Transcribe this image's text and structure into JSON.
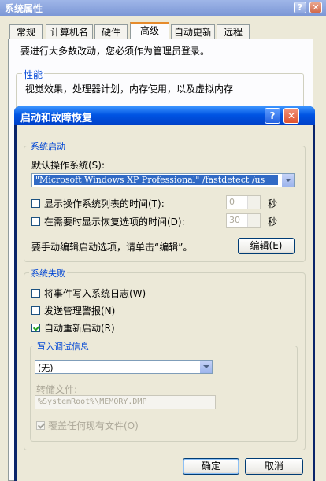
{
  "background_window": {
    "title": "系统属性",
    "tabs": [
      "常规",
      "计算机名",
      "硬件",
      "高级",
      "自动更新",
      "远程"
    ],
    "active_tab": "高级",
    "admin_notice": "要进行大多数改动，您必须作为管理员登录。",
    "performance": {
      "legend": "性能",
      "description": "视觉效果，处理器计划，内存使用，以及虚拟内存"
    }
  },
  "dialog": {
    "title": "启动和故障恢复",
    "help_glyph": "?",
    "close_glyph": "✕",
    "system_startup": {
      "legend": "系统启动",
      "default_os_label": "默认操作系统(S):",
      "default_os_value": "\"Microsoft Windows XP Professional\" /fastdetect  /us",
      "show_os_list_label": "显示操作系统列表的时间(T):",
      "show_os_list_value": "0",
      "show_recovery_label": "在需要时显示恢复选项的时间(D):",
      "show_recovery_value": "30",
      "seconds_unit": "秒",
      "edit_hint": "要手动编辑启动选项，请单击“编辑”。",
      "edit_button": "编辑(E)"
    },
    "system_failure": {
      "legend": "系统失败",
      "write_event_log": {
        "label": "将事件写入系统日志(W)",
        "checked": false
      },
      "send_alert": {
        "label": "发送管理警报(N)",
        "checked": false
      },
      "auto_restart": {
        "label": "自动重新启动(R)",
        "checked": true
      },
      "debug_info": {
        "legend": "写入调试信息",
        "selected": "(无)",
        "dump_file_label": "转储文件:",
        "dump_file_value": "%SystemRoot%\\MEMORY.DMP",
        "overwrite": {
          "label": "覆盖任何现有文件(O)",
          "checked": true
        }
      }
    },
    "ok_button": "确定",
    "cancel_button": "取消"
  },
  "colors": {
    "dialog_title_bar": "#0054e3",
    "group_legend": "#0046d5",
    "close_button": "#e0532f",
    "selection": "#316ac5"
  }
}
